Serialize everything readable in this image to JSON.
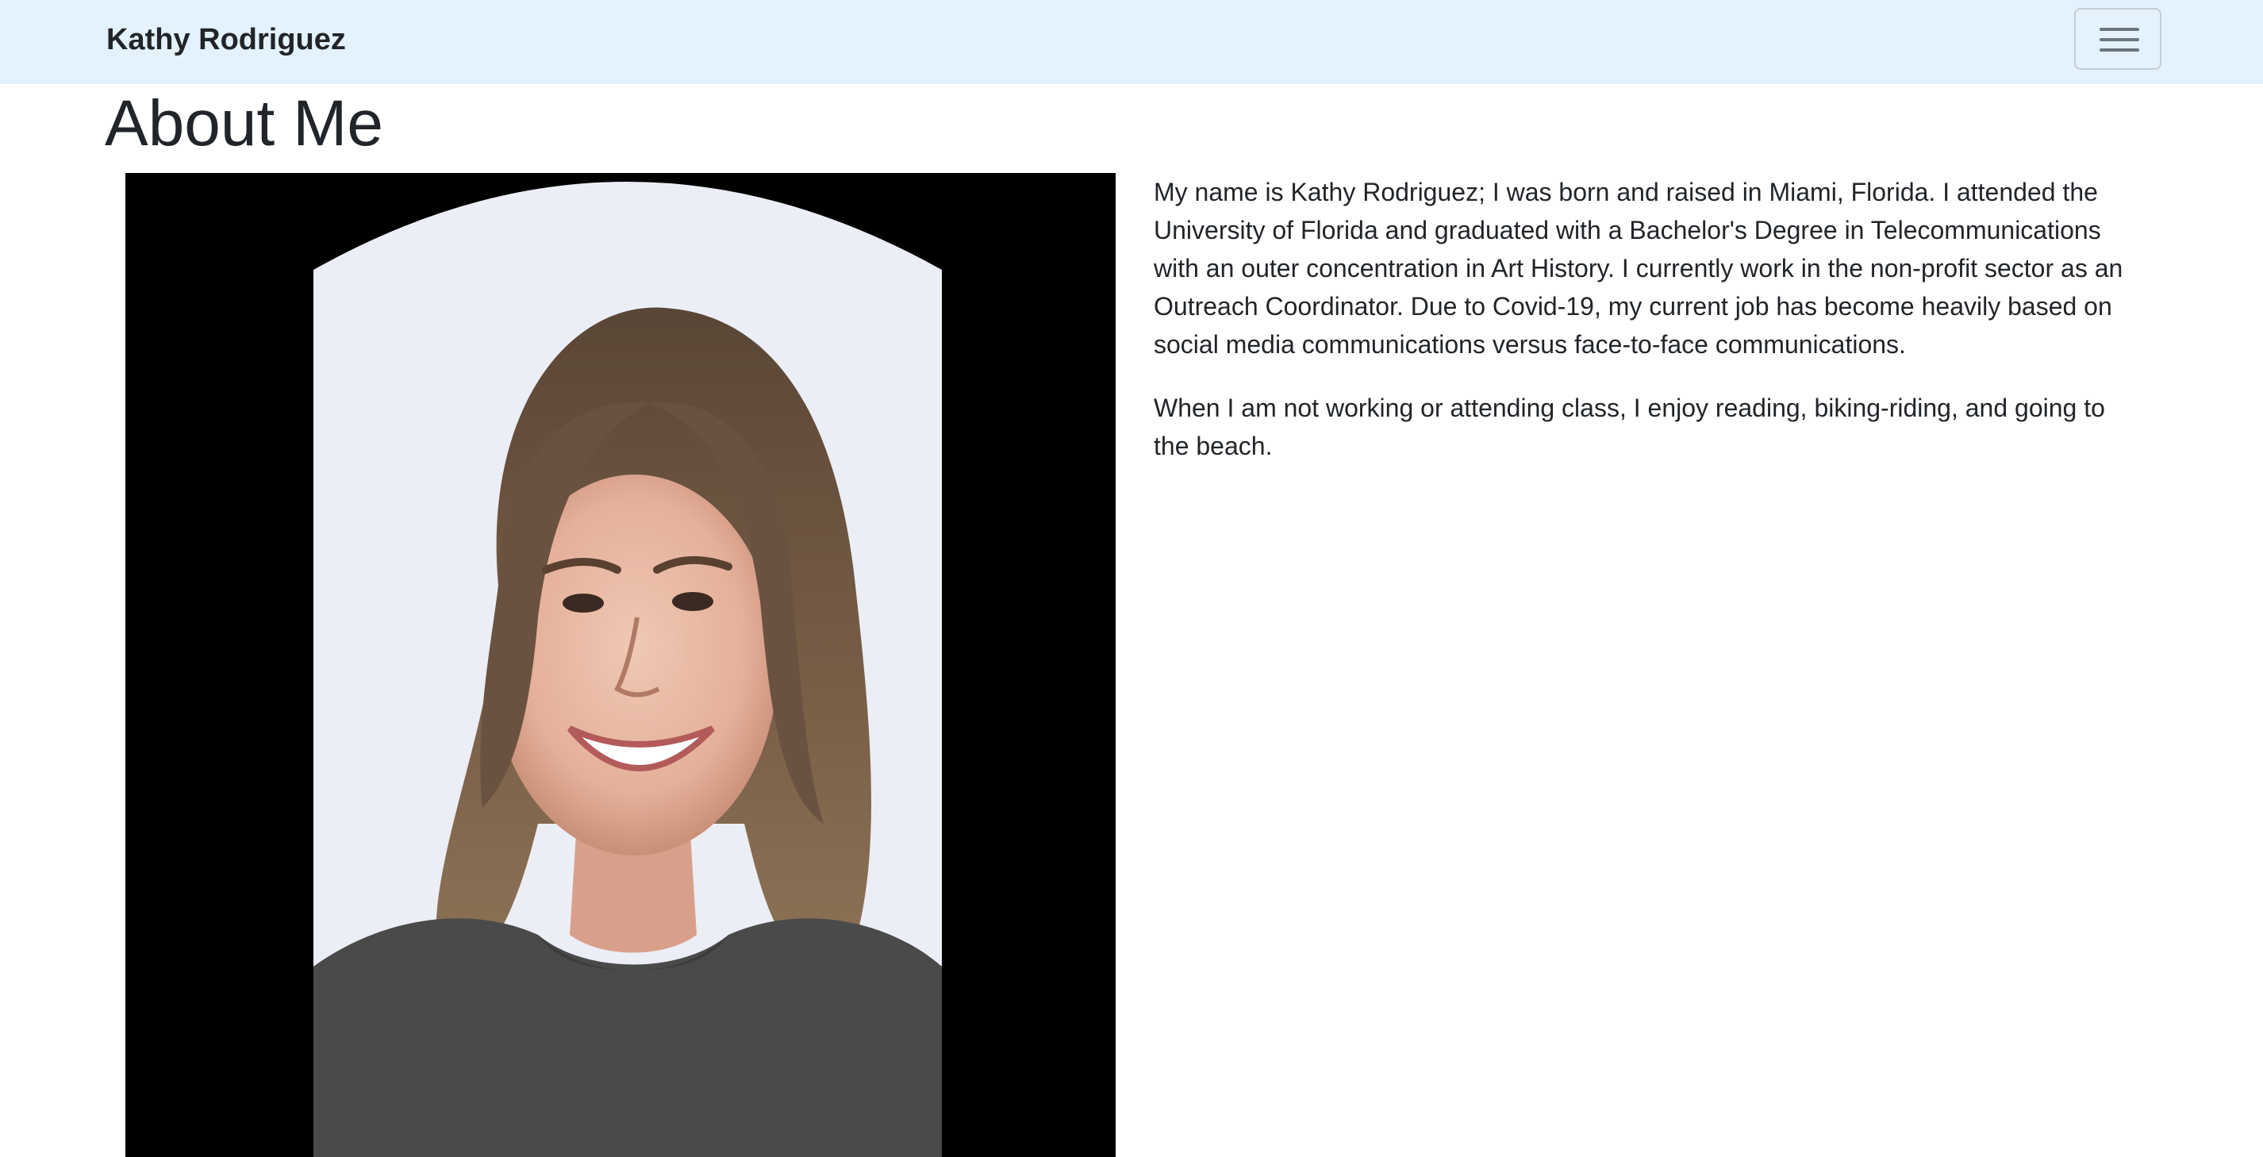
{
  "navbar": {
    "brand": "Kathy Rodriguez",
    "toggler_icon": "hamburger-menu-icon"
  },
  "page": {
    "title": "About Me"
  },
  "profile": {
    "photo_icon": "portrait-photo"
  },
  "bio": {
    "paragraphs": [
      "My name is Kathy Rodriguez; I was born and raised in Miami, Florida. I attended the University of Florida and graduated with a Bachelor's Degree in Telecommunications with an outer concentration in Art History. I currently work in the non-profit sector as an Outreach Coordinator. Due to Covid-19, my current job has become heavily based on social media communications versus face-to-face communications.",
      "When I am not working or attending class, I enjoy reading, biking-riding, and going to the beach."
    ]
  },
  "colors": {
    "navbar_bg": "#e3f2fd",
    "text": "#212529",
    "photo_bg": "#000000"
  }
}
